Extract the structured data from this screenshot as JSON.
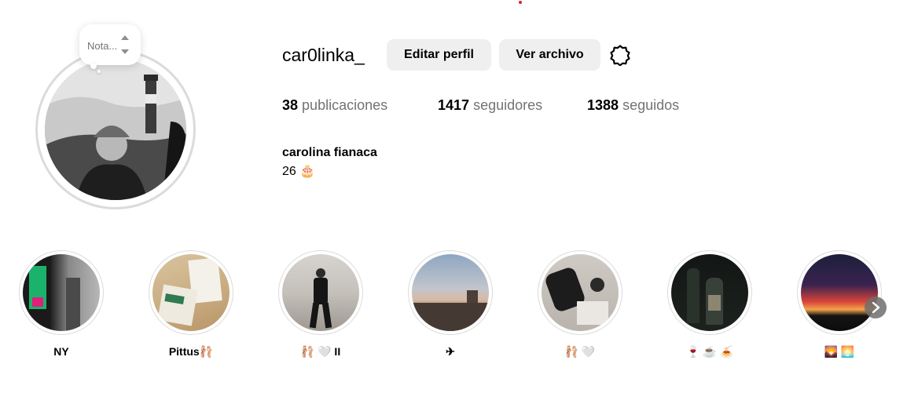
{
  "profile": {
    "username": "car0linka_",
    "full_name": "carolina fianaca",
    "bio": "26 🎂",
    "note_placeholder": "Nota..."
  },
  "buttons": {
    "edit_profile": "Editar perfil",
    "view_archive": "Ver archivo"
  },
  "stats": {
    "posts_count": "38",
    "posts_label": "publicaciones",
    "followers_count": "1417",
    "followers_label": "seguidores",
    "following_count": "1388",
    "following_label": "seguidos"
  },
  "highlights": [
    {
      "label": "NY"
    },
    {
      "label": "Pittus🩰"
    },
    {
      "label": "🩰 🤍 II"
    },
    {
      "label": "✈"
    },
    {
      "label": "🩰 🤍"
    },
    {
      "label": "🍷 ☕ 🍝"
    },
    {
      "label": "🌄 🌅"
    }
  ],
  "icons": {
    "settings": "gear-icon",
    "next": "chevron-right-icon",
    "note_arrows": "up-down-arrows-icon"
  },
  "colors": {
    "button_bg": "#efefef",
    "secondary_text": "#737373",
    "ring": "#dbdbdb",
    "notification_dot": "#e0241b"
  }
}
